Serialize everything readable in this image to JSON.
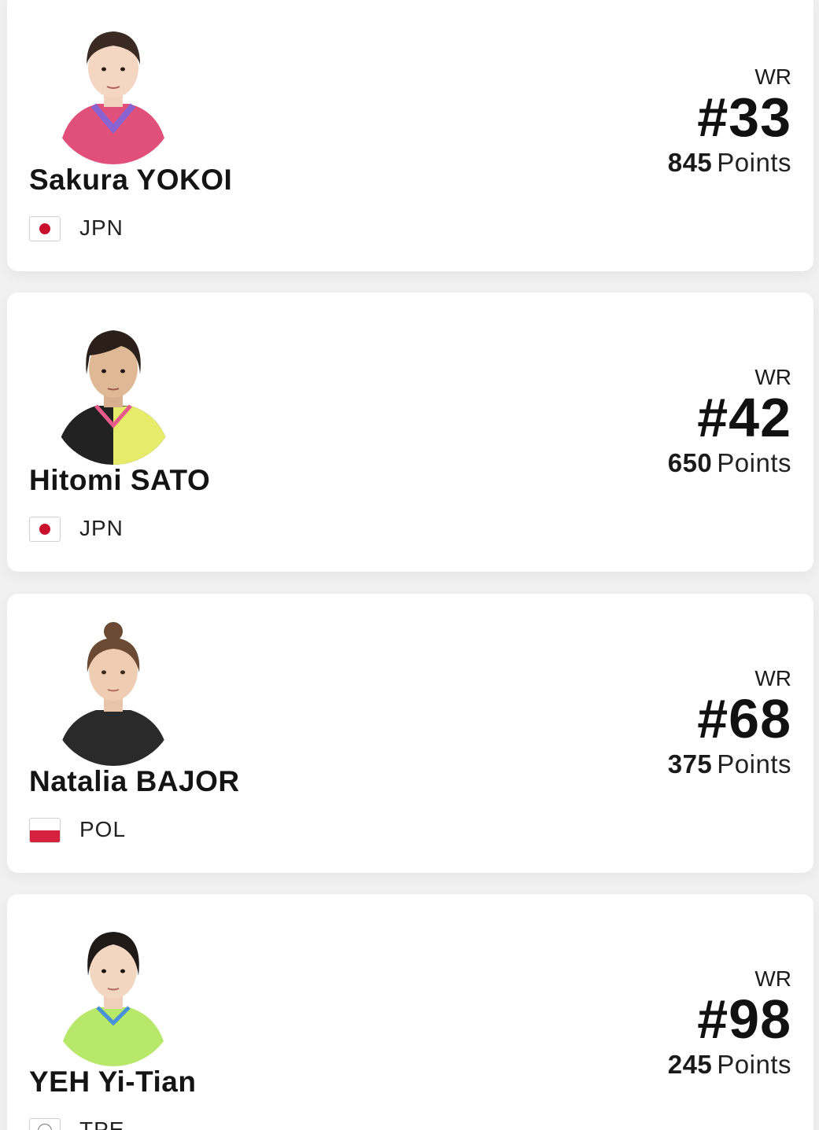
{
  "labels": {
    "wr": "WR",
    "points": "Points"
  },
  "players": [
    {
      "name": "Sakura YOKOI",
      "country": "JPN",
      "flag_icon": "japan-flag-icon",
      "rank": "#33",
      "points": "845",
      "jersey_color": "#e0507a",
      "jersey_accent": "#8a63d2",
      "hair_color": "#3a2a22"
    },
    {
      "name": "Hitomi SATO",
      "country": "JPN",
      "flag_icon": "japan-flag-icon",
      "rank": "#42",
      "points": "650",
      "jersey_color": "#222222",
      "jersey_accent": "#e6ec6a",
      "hair_color": "#2b2019"
    },
    {
      "name": "Natalia BAJOR",
      "country": "POL",
      "flag_icon": "poland-flag-icon",
      "rank": "#68",
      "points": "375",
      "jersey_color": "#2a2a2a",
      "jersey_accent": "#3a3a3a",
      "hair_color": "#6b4a33"
    },
    {
      "name": "YEH Yi-Tian",
      "country": "TPE",
      "flag_icon": "chinese-taipei-flag-icon",
      "rank": "#98",
      "points": "245",
      "jersey_color": "#b8e86a",
      "jersey_accent": "#9fd94e",
      "hair_color": "#1f1a18"
    }
  ]
}
